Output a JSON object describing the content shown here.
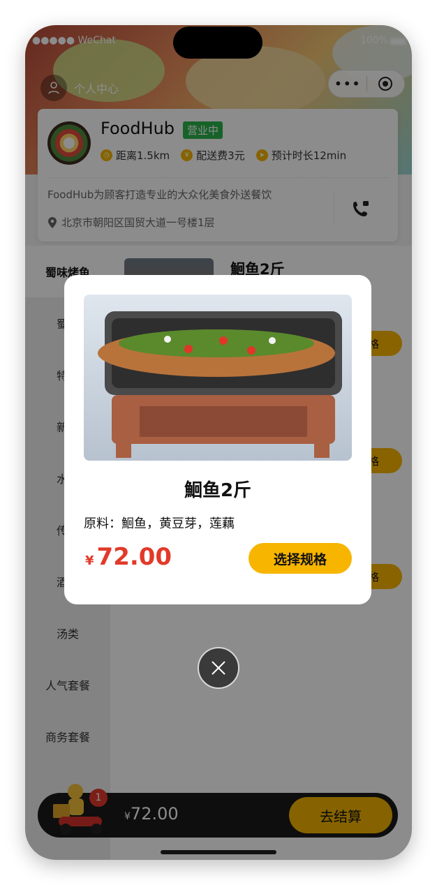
{
  "status_bar": {
    "carrier": "●●●●● WeChat",
    "battery": "100%"
  },
  "header": {
    "user_center_label": "个人中心",
    "more_glyph": "•••"
  },
  "shop": {
    "name": "FoodHub",
    "status_badge": "营业中",
    "distance": "距离1.5km",
    "delivery_fee": "配送费3元",
    "eta": "预计时长12min",
    "description": "FoodHub为顾客打造专业的大众化美食外送餐饮",
    "address": "北京市朝阳区国贸大道一号楼1层"
  },
  "categories": [
    {
      "label": "蜀味烤鱼",
      "active": true
    },
    {
      "label": "蜀味",
      "active": false
    },
    {
      "label": "特色",
      "active": false
    },
    {
      "label": "新鲜",
      "active": false
    },
    {
      "label": "水煮",
      "active": false
    },
    {
      "label": "传统",
      "active": false
    },
    {
      "label": "酒水",
      "active": false
    },
    {
      "label": "汤类",
      "active": false
    },
    {
      "label": "人气套餐",
      "active": false
    },
    {
      "label": "商务套餐",
      "active": false
    }
  ],
  "menu": {
    "items": [
      {
        "title": "鮰鱼2斤",
        "button": "规格"
      },
      {
        "title": "",
        "button": "规格"
      },
      {
        "title": "",
        "button": "规格"
      }
    ]
  },
  "modal": {
    "title": "鮰鱼2斤",
    "ingredients": "原料：鮰鱼，黄豆芽，莲藕",
    "currency": "¥",
    "price": "72.00",
    "select_spec_label": "选择规格"
  },
  "cart": {
    "count": "1",
    "currency": "¥",
    "total": "72.00",
    "checkout_label": "去结算"
  },
  "colors": {
    "accent": "#f7b500",
    "price_red": "#e23a2a",
    "open_green": "#2bb24c",
    "dark_bar": "#1a1a1a"
  }
}
